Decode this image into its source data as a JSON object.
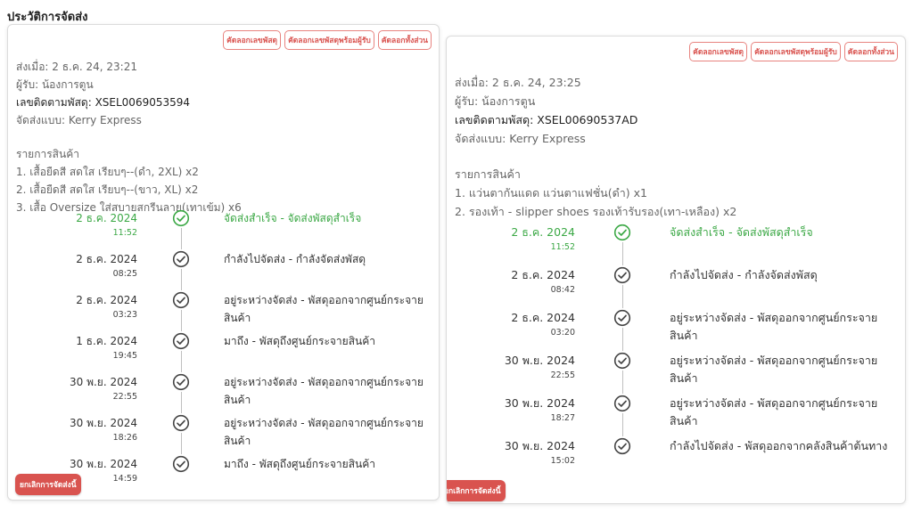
{
  "page_title": "ประวัติการจัดส่ง",
  "colors": {
    "accent": "#d9534f",
    "success": "#3ba845"
  },
  "cards": [
    {
      "buttons": {
        "copy_tracking": "คัดลอกเลขพัสดุ",
        "copy_tracking_receiver": "คัดลอกเลขพัสดุพร้อมผู้รับ",
        "copy_all": "คัดลอกทั้งส่วน"
      },
      "sent_at": "ส่งเมื่อ: 2 ธ.ค. 24, 23:21",
      "receiver": "ผู้รับ: น้องการตูน",
      "tracking": "เลขติดตามพัสดุ: XSEL0069053594",
      "carrier": "จัดส่งแบบ: Kerry Express",
      "items_title": "รายการสินค้า",
      "items": [
        "1. เสื้อยืดสี สดใส เรียบๆ--(ดำ, 2XL) x2",
        "2. เสื้อยืดสี สดใส เรียบๆ--(ขาว, XL) x2",
        "3. เสื้อ Oversize ใส่สบายสกรีนลาย(เทาเข้ม) x6"
      ],
      "timeline": [
        {
          "date": "2 ธ.ค. 2024",
          "time": "11:52",
          "status": "จัดส่งสำเร็จ - จัดส่งพัสดุสำเร็จ",
          "success": true
        },
        {
          "date": "2 ธ.ค. 2024",
          "time": "08:25",
          "status": "กำลังไปจัดส่ง - กำลังจัดส่งพัสดุ",
          "success": false
        },
        {
          "date": "2 ธ.ค. 2024",
          "time": "03:23",
          "status": "อยู่ระหว่างจัดส่ง - พัสดุออกจากศูนย์กระจายสินค้า",
          "success": false
        },
        {
          "date": "1 ธ.ค. 2024",
          "time": "19:45",
          "status": "มาถึง - พัสดุถึงศูนย์กระจายสินค้า",
          "success": false
        },
        {
          "date": "30 พ.ย. 2024",
          "time": "22:55",
          "status": "อยู่ระหว่างจัดส่ง - พัสดุออกจากศูนย์กระจายสินค้า",
          "success": false
        },
        {
          "date": "30 พ.ย. 2024",
          "time": "18:26",
          "status": "อยู่ระหว่างจัดส่ง - พัสดุออกจากศูนย์กระจายสินค้า",
          "success": false
        },
        {
          "date": "30 พ.ย. 2024",
          "time": "14:59",
          "status": "มาถึง - พัสดุถึงศูนย์กระจายสินค้า",
          "success": false
        }
      ],
      "cancel_label": "ยกเลิกการจัดส่งนี้"
    },
    {
      "buttons": {
        "copy_tracking": "คัดลอกเลขพัสดุ",
        "copy_tracking_receiver": "คัดลอกเลขพัสดุพร้อมผู้รับ",
        "copy_all": "คัดลอกทั้งส่วน"
      },
      "sent_at": "ส่งเมื่อ: 2 ธ.ค. 24, 23:25",
      "receiver": "ผู้รับ: น้องการตูน",
      "tracking": "เลขติดตามพัสดุ: XSEL00690537AD",
      "carrier": "จัดส่งแบบ: Kerry Express",
      "items_title": "รายการสินค้า",
      "items": [
        "1. แว่นตากันแดด แว่นตาแฟชั่น(ดำ) x1",
        "2. รองเท้า - slipper shoes รองเท้ารับรอง(เทา-เหลือง) x2"
      ],
      "timeline": [
        {
          "date": "2 ธ.ค. 2024",
          "time": "11:52",
          "status": "จัดส่งสำเร็จ - จัดส่งพัสดุสำเร็จ",
          "success": true
        },
        {
          "date": "2 ธ.ค. 2024",
          "time": "08:42",
          "status": "กำลังไปจัดส่ง - กำลังจัดส่งพัสดุ",
          "success": false
        },
        {
          "date": "2 ธ.ค. 2024",
          "time": "03:20",
          "status": "อยู่ระหว่างจัดส่ง - พัสดุออกจากศูนย์กระจายสินค้า",
          "success": false
        },
        {
          "date": "30 พ.ย. 2024",
          "time": "22:55",
          "status": "อยู่ระหว่างจัดส่ง - พัสดุออกจากศูนย์กระจายสินค้า",
          "success": false
        },
        {
          "date": "30 พ.ย. 2024",
          "time": "18:27",
          "status": "อยู่ระหว่างจัดส่ง - พัสดุออกจากศูนย์กระจายสินค้า",
          "success": false
        },
        {
          "date": "30 พ.ย. 2024",
          "time": "15:02",
          "status": "กำลังไปจัดส่ง - พัสดุออกจากคลังสินค้าต้นทาง",
          "success": false
        }
      ],
      "cancel_label": "ยกเลิกการจัดส่งนี้"
    }
  ]
}
